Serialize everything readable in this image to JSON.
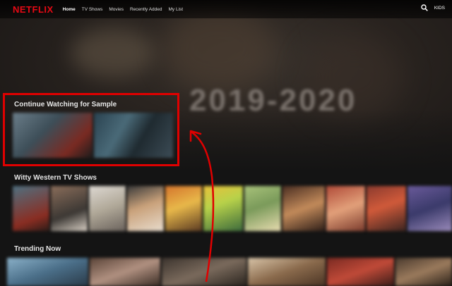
{
  "navbar": {
    "logo": "NETFLIX",
    "links": [
      "Home",
      "TV Shows",
      "Movies",
      "Recently Added",
      "My List"
    ],
    "kids_label": "KIDS"
  },
  "hero": {
    "years": "2019-2020"
  },
  "rows": {
    "continue_watching": "Continue Watching for Sample",
    "witty_western": "Witty Western TV Shows",
    "trending": "Trending Now"
  },
  "colors": {
    "brand_red": "#e50914",
    "annotation_red": "#e00000",
    "background": "#141414"
  }
}
